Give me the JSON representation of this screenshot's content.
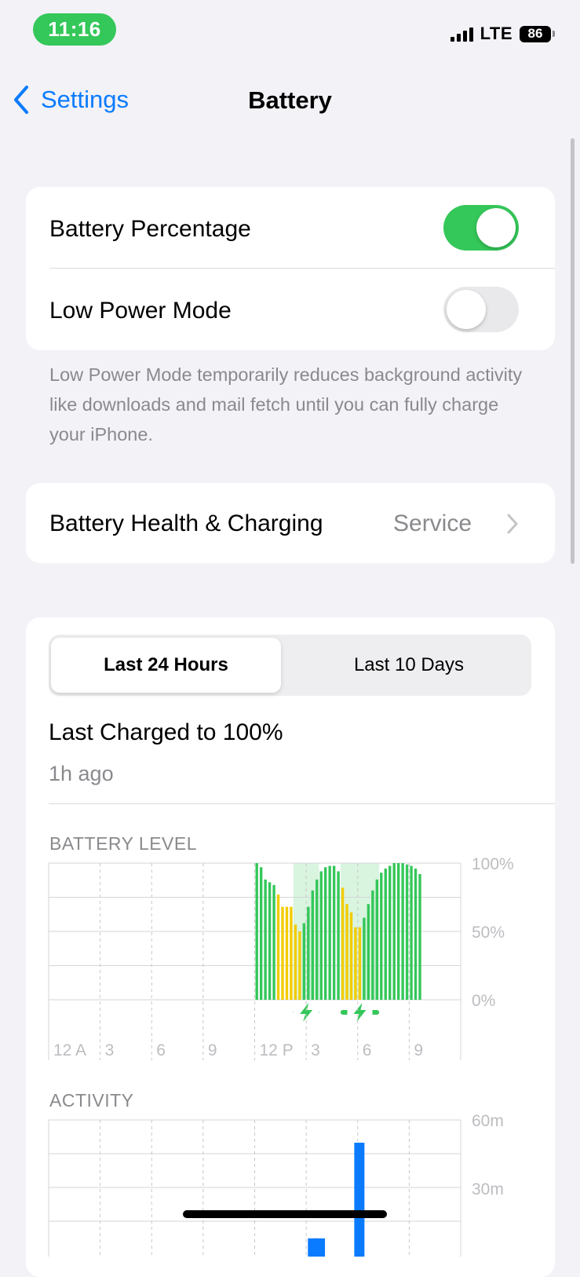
{
  "status_bar": {
    "time": "11:16",
    "network": "LTE",
    "battery_level": "86"
  },
  "nav": {
    "back_label": "Settings",
    "title": "Battery"
  },
  "settings": {
    "battery_percentage": {
      "label": "Battery Percentage",
      "on": true
    },
    "low_power_mode": {
      "label": "Low Power Mode",
      "on": false
    },
    "low_power_footnote": "Low Power Mode temporarily reduces background activity like downloads and mail fetch until you can fully charge your iPhone.",
    "health": {
      "label": "Battery Health & Charging",
      "value": "Service"
    }
  },
  "usage": {
    "tabs": [
      "Last 24 Hours",
      "Last 10 Days"
    ],
    "active_tab": 0,
    "last_charged_title": "Last Charged to 100%",
    "last_charged_time": "1h ago"
  },
  "colors": {
    "accent": "#0a7bff",
    "toggle_on": "#34c759",
    "battery_bar_normal": "#34c759",
    "battery_bar_low_power": "#f2cc00",
    "charging_band": "#d9f4df",
    "activity_bar": "#0a7bff"
  },
  "chart_data": [
    {
      "type": "bar",
      "title": "BATTERY LEVEL",
      "x_tick_labels": [
        "12 A",
        "3",
        "6",
        "9",
        "12 P",
        "3",
        "6",
        "9"
      ],
      "y_tick_labels": [
        "100%",
        "50%",
        "0%"
      ],
      "ylim": [
        0,
        100
      ],
      "slots_per_hour": 4,
      "bars": [
        {
          "slot": 0,
          "value": 100,
          "mode": "normal"
        },
        {
          "slot": 1,
          "value": 97,
          "mode": "normal"
        },
        {
          "slot": 2,
          "value": 88,
          "mode": "normal"
        },
        {
          "slot": 3,
          "value": 86,
          "mode": "normal"
        },
        {
          "slot": 4,
          "value": 84,
          "mode": "normal"
        },
        {
          "slot": 5,
          "value": 77,
          "mode": "low_power"
        },
        {
          "slot": 6,
          "value": 68,
          "mode": "low_power"
        },
        {
          "slot": 7,
          "value": 68,
          "mode": "low_power"
        },
        {
          "slot": 8,
          "value": 68,
          "mode": "low_power"
        },
        {
          "slot": 9,
          "value": 55,
          "mode": "low_power"
        },
        {
          "slot": 10,
          "value": 50,
          "mode": "low_power"
        },
        {
          "slot": 11,
          "value": 56,
          "mode": "normal"
        },
        {
          "slot": 12,
          "value": 68,
          "mode": "normal"
        },
        {
          "slot": 13,
          "value": 80,
          "mode": "normal"
        },
        {
          "slot": 14,
          "value": 88,
          "mode": "normal"
        },
        {
          "slot": 15,
          "value": 94,
          "mode": "normal"
        },
        {
          "slot": 16,
          "value": 97,
          "mode": "normal"
        },
        {
          "slot": 17,
          "value": 98,
          "mode": "normal"
        },
        {
          "slot": 18,
          "value": 98,
          "mode": "normal"
        },
        {
          "slot": 19,
          "value": 94,
          "mode": "normal"
        },
        {
          "slot": 20,
          "value": 82,
          "mode": "low_power"
        },
        {
          "slot": 21,
          "value": 70,
          "mode": "low_power"
        },
        {
          "slot": 22,
          "value": 64,
          "mode": "low_power"
        },
        {
          "slot": 23,
          "value": 53,
          "mode": "low_power"
        },
        {
          "slot": 24,
          "value": 53,
          "mode": "low_power"
        },
        {
          "slot": 25,
          "value": 60,
          "mode": "normal"
        },
        {
          "slot": 26,
          "value": 70,
          "mode": "normal"
        },
        {
          "slot": 27,
          "value": 80,
          "mode": "normal"
        },
        {
          "slot": 28,
          "value": 88,
          "mode": "normal"
        },
        {
          "slot": 29,
          "value": 93,
          "mode": "normal"
        },
        {
          "slot": 30,
          "value": 96,
          "mode": "normal"
        },
        {
          "slot": 31,
          "value": 98,
          "mode": "normal"
        },
        {
          "slot": 32,
          "value": 100,
          "mode": "normal"
        },
        {
          "slot": 33,
          "value": 100,
          "mode": "normal"
        },
        {
          "slot": 34,
          "value": 100,
          "mode": "normal"
        },
        {
          "slot": 35,
          "value": 99,
          "mode": "normal"
        },
        {
          "slot": 36,
          "value": 98,
          "mode": "normal"
        },
        {
          "slot": 37,
          "value": 96,
          "mode": "normal"
        },
        {
          "slot": 38,
          "value": 92,
          "mode": "normal"
        }
      ],
      "bars_start_hour": 12,
      "charging_periods_hours": [
        [
          14.25,
          15.75
        ],
        [
          17.0,
          19.25
        ]
      ]
    },
    {
      "type": "bar",
      "title": "ACTIVITY",
      "x_tick_labels": [
        "12 A",
        "3",
        "6",
        "9",
        "12 P",
        "3",
        "6",
        "9"
      ],
      "y_tick_labels": [
        "60m",
        "30m"
      ],
      "ylim": [
        0,
        60
      ],
      "unit": "minutes",
      "bars": [
        {
          "hour": 15.1,
          "value": 8
        },
        {
          "hour": 15.5,
          "value": 8
        },
        {
          "hour": 17.8,
          "value": 50
        }
      ]
    }
  ]
}
